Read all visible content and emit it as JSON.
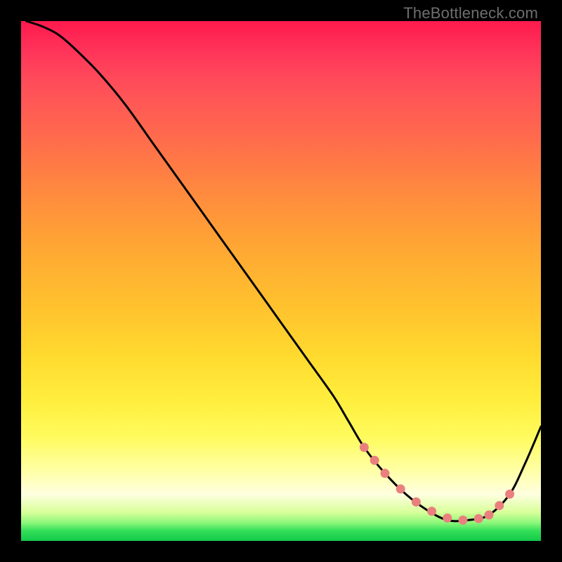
{
  "attribution": "TheBottleneck.com",
  "colors": {
    "page_bg": "#000000",
    "curve_stroke": "#000000",
    "dot_fill": "#e9807e",
    "gradient_stops": [
      "#ff1a4d",
      "#ff355a",
      "#ff4d5a",
      "#ff6a4d",
      "#ff8a3e",
      "#ffa833",
      "#ffc22e",
      "#ffd92e",
      "#ffee3d",
      "#fffb5e",
      "#ffffa0",
      "#ffffe0",
      "#d8ff9a",
      "#8cf77a",
      "#35e05a",
      "#13c94a"
    ]
  },
  "chart_data": {
    "type": "line",
    "xlabel": "",
    "ylabel": "",
    "title": "",
    "xlim": [
      0,
      100
    ],
    "ylim": [
      0,
      100
    ],
    "series": [
      {
        "name": "bottleneck-curve",
        "x": [
          1,
          4,
          7,
          10,
          15,
          20,
          25,
          30,
          35,
          40,
          45,
          50,
          55,
          60,
          63,
          66,
          70,
          74,
          78,
          82,
          86,
          90,
          94,
          97,
          100
        ],
        "y": [
          100,
          99,
          97.5,
          95,
          90,
          84,
          77,
          70,
          63,
          56,
          49,
          42,
          35,
          28,
          23,
          18,
          13,
          9,
          6,
          4,
          4,
          5,
          9,
          15,
          22
        ]
      }
    ],
    "highlight_dots": {
      "x": [
        66,
        68,
        70,
        73,
        76,
        79,
        82,
        85,
        88,
        90,
        92,
        94
      ],
      "y": [
        18,
        15.5,
        13,
        10,
        7.5,
        5.7,
        4.4,
        4,
        4.3,
        5,
        6.8,
        9
      ]
    }
  }
}
